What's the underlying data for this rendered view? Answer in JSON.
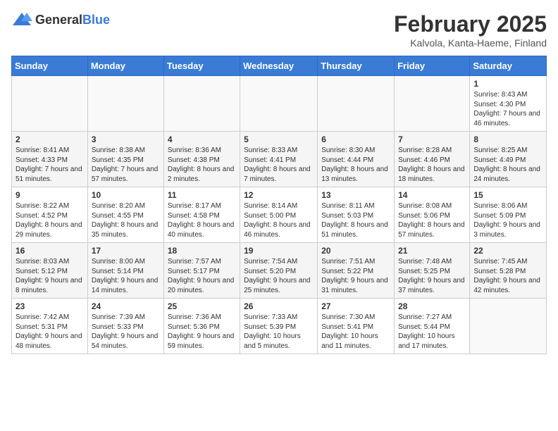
{
  "header": {
    "logo_general": "General",
    "logo_blue": "Blue",
    "month_title": "February 2025",
    "location": "Kalvola, Kanta-Haeme, Finland"
  },
  "days_of_week": [
    "Sunday",
    "Monday",
    "Tuesday",
    "Wednesday",
    "Thursday",
    "Friday",
    "Saturday"
  ],
  "weeks": [
    [
      {
        "day": "",
        "info": ""
      },
      {
        "day": "",
        "info": ""
      },
      {
        "day": "",
        "info": ""
      },
      {
        "day": "",
        "info": ""
      },
      {
        "day": "",
        "info": ""
      },
      {
        "day": "",
        "info": ""
      },
      {
        "day": "1",
        "info": "Sunrise: 8:43 AM\nSunset: 4:30 PM\nDaylight: 7 hours and 46 minutes."
      }
    ],
    [
      {
        "day": "2",
        "info": "Sunrise: 8:41 AM\nSunset: 4:33 PM\nDaylight: 7 hours and 51 minutes."
      },
      {
        "day": "3",
        "info": "Sunrise: 8:38 AM\nSunset: 4:35 PM\nDaylight: 7 hours and 57 minutes."
      },
      {
        "day": "4",
        "info": "Sunrise: 8:36 AM\nSunset: 4:38 PM\nDaylight: 8 hours and 2 minutes."
      },
      {
        "day": "5",
        "info": "Sunrise: 8:33 AM\nSunset: 4:41 PM\nDaylight: 8 hours and 7 minutes."
      },
      {
        "day": "6",
        "info": "Sunrise: 8:30 AM\nSunset: 4:44 PM\nDaylight: 8 hours and 13 minutes."
      },
      {
        "day": "7",
        "info": "Sunrise: 8:28 AM\nSunset: 4:46 PM\nDaylight: 8 hours and 18 minutes."
      },
      {
        "day": "8",
        "info": "Sunrise: 8:25 AM\nSunset: 4:49 PM\nDaylight: 8 hours and 24 minutes."
      }
    ],
    [
      {
        "day": "9",
        "info": "Sunrise: 8:22 AM\nSunset: 4:52 PM\nDaylight: 8 hours and 29 minutes."
      },
      {
        "day": "10",
        "info": "Sunrise: 8:20 AM\nSunset: 4:55 PM\nDaylight: 8 hours and 35 minutes."
      },
      {
        "day": "11",
        "info": "Sunrise: 8:17 AM\nSunset: 4:58 PM\nDaylight: 8 hours and 40 minutes."
      },
      {
        "day": "12",
        "info": "Sunrise: 8:14 AM\nSunset: 5:00 PM\nDaylight: 8 hours and 46 minutes."
      },
      {
        "day": "13",
        "info": "Sunrise: 8:11 AM\nSunset: 5:03 PM\nDaylight: 8 hours and 51 minutes."
      },
      {
        "day": "14",
        "info": "Sunrise: 8:08 AM\nSunset: 5:06 PM\nDaylight: 8 hours and 57 minutes."
      },
      {
        "day": "15",
        "info": "Sunrise: 8:06 AM\nSunset: 5:09 PM\nDaylight: 9 hours and 3 minutes."
      }
    ],
    [
      {
        "day": "16",
        "info": "Sunrise: 8:03 AM\nSunset: 5:12 PM\nDaylight: 9 hours and 8 minutes."
      },
      {
        "day": "17",
        "info": "Sunrise: 8:00 AM\nSunset: 5:14 PM\nDaylight: 9 hours and 14 minutes."
      },
      {
        "day": "18",
        "info": "Sunrise: 7:57 AM\nSunset: 5:17 PM\nDaylight: 9 hours and 20 minutes."
      },
      {
        "day": "19",
        "info": "Sunrise: 7:54 AM\nSunset: 5:20 PM\nDaylight: 9 hours and 25 minutes."
      },
      {
        "day": "20",
        "info": "Sunrise: 7:51 AM\nSunset: 5:22 PM\nDaylight: 9 hours and 31 minutes."
      },
      {
        "day": "21",
        "info": "Sunrise: 7:48 AM\nSunset: 5:25 PM\nDaylight: 9 hours and 37 minutes."
      },
      {
        "day": "22",
        "info": "Sunrise: 7:45 AM\nSunset: 5:28 PM\nDaylight: 9 hours and 42 minutes."
      }
    ],
    [
      {
        "day": "23",
        "info": "Sunrise: 7:42 AM\nSunset: 5:31 PM\nDaylight: 9 hours and 48 minutes."
      },
      {
        "day": "24",
        "info": "Sunrise: 7:39 AM\nSunset: 5:33 PM\nDaylight: 9 hours and 54 minutes."
      },
      {
        "day": "25",
        "info": "Sunrise: 7:36 AM\nSunset: 5:36 PM\nDaylight: 9 hours and 59 minutes."
      },
      {
        "day": "26",
        "info": "Sunrise: 7:33 AM\nSunset: 5:39 PM\nDaylight: 10 hours and 5 minutes."
      },
      {
        "day": "27",
        "info": "Sunrise: 7:30 AM\nSunset: 5:41 PM\nDaylight: 10 hours and 11 minutes."
      },
      {
        "day": "28",
        "info": "Sunrise: 7:27 AM\nSunset: 5:44 PM\nDaylight: 10 hours and 17 minutes."
      },
      {
        "day": "",
        "info": ""
      }
    ]
  ]
}
